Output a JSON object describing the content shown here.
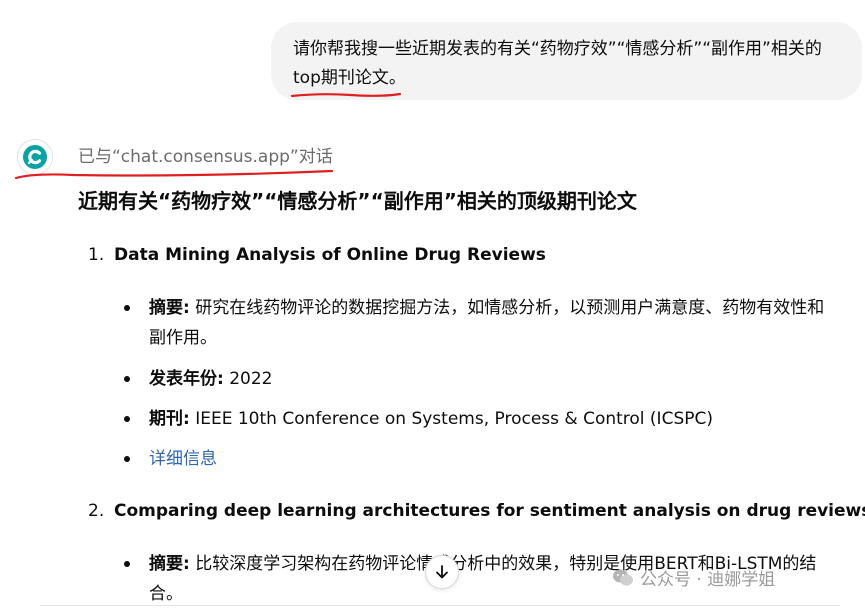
{
  "user_message": {
    "line1": "请你帮我搜一些近期发表的有关“药物疗效”“情感分析”“副作用”相关的",
    "line2_underlined": "top期刊论文",
    "line2_end": "。"
  },
  "assistant": {
    "tool_status": "已与“chat.consensus.app”对话",
    "heading": "近期有关“药物疗效”“情感分析”“副作用”相关的顶级期刊论文",
    "papers": [
      {
        "num": "1.",
        "title": "Data Mining Analysis of Online Drug Reviews",
        "abstract_label": "摘要:",
        "abstract_line1": " 研究在线药物评论的数据挖掘方法，如情感分析，以预测用户满意度、药物有效性和",
        "abstract_line2": "副作用。",
        "year_label": "发表年份:",
        "year": " 2022",
        "journal_label": "期刊:",
        "journal": " IEEE 10th Conference on Systems, Process & Control (ICSPC)",
        "link": "详细信息"
      },
      {
        "num": "2.",
        "title": "Comparing deep learning architectures for sentiment analysis on drug reviews",
        "abstract_label": "摘要:",
        "abstract_line1": " 比较深度学习架构在药物评论情感分析中的效果，特别是使用BERT和Bi-LSTM的结",
        "abstract_line2": "合。"
      }
    ]
  },
  "watermark": {
    "text": "公众号 · 迪娜学姐",
    "icon": "wechat-icon"
  },
  "icons": {
    "scroll": "arrow-down-icon",
    "avatar": "consensus-logo-icon"
  },
  "colors": {
    "link": "#2f66b3",
    "annotation": "#e02020",
    "bubble": "#f3f3f3"
  }
}
